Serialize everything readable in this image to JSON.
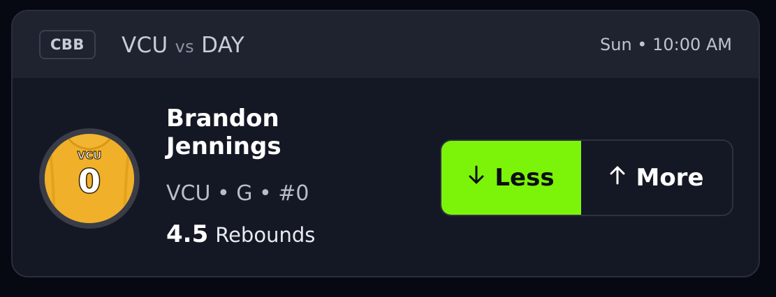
{
  "header": {
    "league": "CBB",
    "team_home": "VCU",
    "vs_label": "vs",
    "team_away": "DAY",
    "game_time": "Sun • 10:00 AM"
  },
  "player": {
    "name": "Brandon Jennings",
    "meta": "VCU • G • #0",
    "jersey_text": "VCU",
    "jersey_number": "0",
    "jersey_color": "#f2b531"
  },
  "stat": {
    "value": "4.5",
    "name": "Rebounds"
  },
  "pick": {
    "less_label": "Less",
    "more_label": "More",
    "less_icon": "arrow-down-icon",
    "more_icon": "arrow-up-icon",
    "selected": "less",
    "accent": "#7cf40a"
  }
}
